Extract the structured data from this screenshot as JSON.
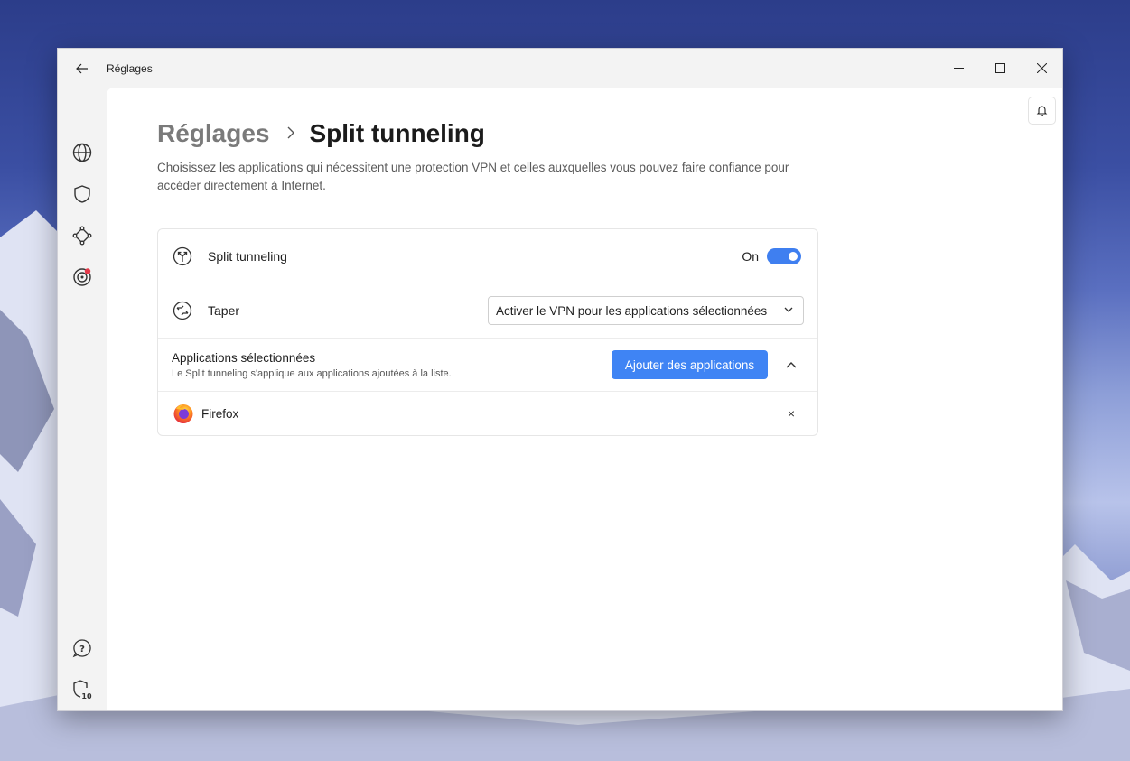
{
  "window": {
    "title": "Réglages"
  },
  "page": {
    "breadcrumb_parent": "Réglages",
    "breadcrumb_current": "Split tunneling",
    "description": "Choisissez les applications qui nécessitent une protection VPN et celles auxquelles vous pouvez faire confiance pour accéder directement à Internet."
  },
  "settings": {
    "split_tunneling": {
      "label": "Split tunneling",
      "state_label": "On",
      "enabled": true
    },
    "type": {
      "label": "Taper",
      "selected": "Activer le VPN pour les applications sélectionnées"
    },
    "selected_apps": {
      "title": "Applications sélectionnées",
      "subtitle": "Le Split tunneling s'applique aux applications ajoutées à la liste.",
      "add_button": "Ajouter des applications",
      "apps": [
        {
          "name": "Firefox",
          "remove_glyph": "×"
        }
      ]
    }
  },
  "sidebar": {
    "items": [
      {
        "icon": "globe-icon"
      },
      {
        "icon": "shield-icon"
      },
      {
        "icon": "network-icon"
      },
      {
        "icon": "target-icon",
        "badge": true
      },
      {
        "icon": "help-icon"
      },
      {
        "icon": "shield-ten-icon",
        "badge_text": "10"
      },
      {
        "icon": "gear-icon",
        "active": true
      }
    ]
  },
  "colors": {
    "accent": "#3f84f4",
    "toggle_on": "#3f7ff0",
    "notification_dot": "#e5394a"
  }
}
